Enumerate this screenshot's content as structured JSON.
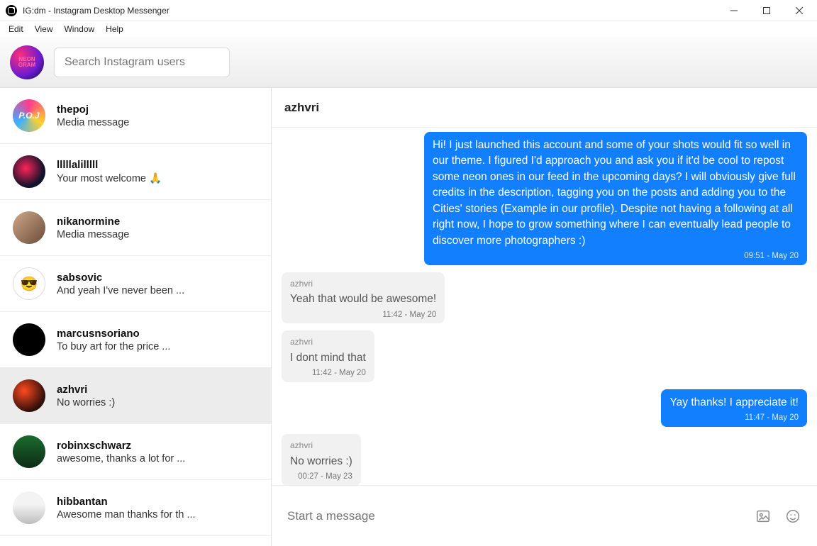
{
  "window": {
    "title": "IG:dm - Instagram Desktop Messenger"
  },
  "menubar": [
    "Edit",
    "View",
    "Window",
    "Help"
  ],
  "search": {
    "placeholder": "Search Instagram users"
  },
  "conversations": [
    {
      "name": "thepoj",
      "preview": "Media message",
      "avatar": "av-thepoj",
      "active": false,
      "initials": "P.O.J"
    },
    {
      "name": "lllllalilllll",
      "preview": "Your most welcome 🙏",
      "avatar": "av-lll",
      "active": false
    },
    {
      "name": "nikanormine",
      "preview": "Media message",
      "avatar": "av-nika",
      "active": false
    },
    {
      "name": "sabsovic",
      "preview": "And yeah I've never been ...",
      "avatar": "av-sab",
      "active": false,
      "emoji": "😎"
    },
    {
      "name": "marcusnsoriano",
      "preview": "To buy art for the price ...",
      "avatar": "av-marcus",
      "active": false
    },
    {
      "name": "azhvri",
      "preview": "No worries :)",
      "avatar": "av-azh",
      "active": true
    },
    {
      "name": "robinxschwarz",
      "preview": "awesome, thanks a lot for ...",
      "avatar": "av-robin",
      "active": false
    },
    {
      "name": "hibbantan",
      "preview": "Awesome man thanks for th ...",
      "avatar": "av-hibb",
      "active": false
    }
  ],
  "chat": {
    "title": "azhvri",
    "messages": [
      {
        "dir": "out",
        "text": "Hi! I just launched this account and some of your shots would fit so well in our theme. I figured I'd approach you and ask you if it'd be cool to repost some neon ones in our feed in the upcoming days? I will obviously give full credits in the description, tagging you on the posts and adding you to the Cities' stories (Example in our profile). Despite not having a following at all right now, I hope to grow something where I can eventually lead people to discover more photographers :)",
        "ts": "09:51 - May 20"
      },
      {
        "dir": "in",
        "sender": "azhvri",
        "text": "Yeah that would be awesome!",
        "ts": "11:42 - May 20"
      },
      {
        "dir": "in",
        "sender": "azhvri",
        "text": "I dont mind that",
        "ts": "11:42 - May 20"
      },
      {
        "dir": "out",
        "text": "Yay thanks! I appreciate it!",
        "ts": "11:47 - May 20"
      },
      {
        "dir": "in",
        "sender": "azhvri",
        "text": "No worries :)",
        "ts": "00:27 - May 23"
      }
    ],
    "composer_placeholder": "Start a message"
  }
}
